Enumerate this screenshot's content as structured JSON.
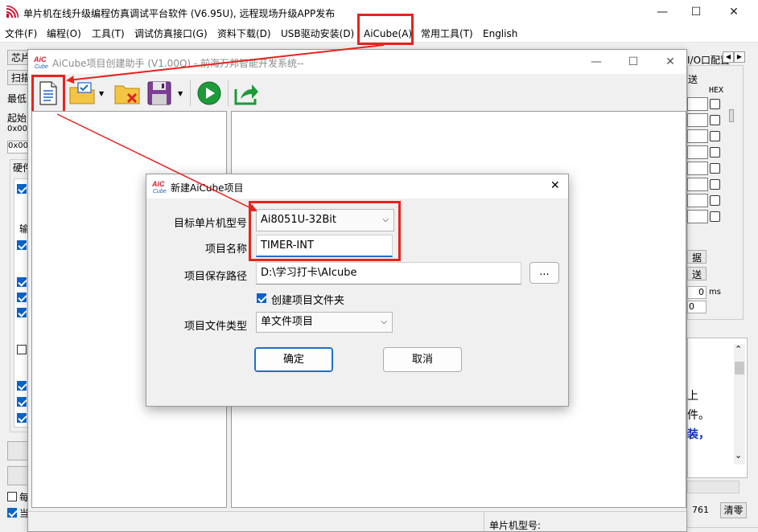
{
  "main_window": {
    "title": "单片机在线升级编程仿真调试平台软件 (V6.95U), 远程现场升级APP发布",
    "minimize": "—",
    "maximize": "☐",
    "close": "✕"
  },
  "menu": [
    {
      "label": "文件(F)"
    },
    {
      "label": "编程(O)"
    },
    {
      "label": "工具(T)"
    },
    {
      "label": "调试仿真接口(G)"
    },
    {
      "label": "资料下载(D)"
    },
    {
      "label": "USB驱动安装(D)"
    },
    {
      "label": "AiCube(A)"
    },
    {
      "label": "常用工具(T)"
    },
    {
      "label": "English"
    }
  ],
  "left_panel": {
    "chip_btn": "芯片",
    "scan_btn": "扫描",
    "lowest_label": "最低",
    "start_label": "起始",
    "addr1": "0x00",
    "addr2": "0x00",
    "hw_label": "硬件",
    "out_label": "输",
    "every_label": "每",
    "current_label": "当"
  },
  "right_panel": {
    "io_config": "I/O口配置",
    "send_label": "送",
    "hex_label": "HEX",
    "data_btn": "据",
    "send_btn": "送",
    "ms_value": "0",
    "ms_unit": "ms",
    "zero_value": "0",
    "text1": "上",
    "text2": "件。",
    "text3": "装，",
    "count": "761",
    "clear_btn": "清零"
  },
  "status_bar": {
    "chip_model_label": "单片机型号:"
  },
  "aicube_window": {
    "title": "AiCube项目创建助手 (V1.00Q) - 前海万邦智能开发系统--",
    "minimize": "—",
    "maximize": "☐",
    "close": "✕"
  },
  "new_project_dialog": {
    "title": "新建AiCube项目",
    "close": "✕",
    "target_mcu_label": "目标单片机型号",
    "target_mcu_value": "Ai8051U-32Bit",
    "project_name_label": "项目名称",
    "project_name_value": "TIMER-INT",
    "save_path_label": "项目保存路径",
    "save_path_value": "D:\\学习打卡\\AIcube",
    "browse_btn": "...",
    "create_folder_label": "创建项目文件夹",
    "project_type_label": "项目文件类型",
    "project_type_value": "单文件项目",
    "ok_btn": "确定",
    "cancel_btn": "取消"
  },
  "colors": {
    "annotation_red": "#e8231d",
    "checkbox_blue": "#0a64c8",
    "accent_blue": "#1f6fc5"
  }
}
